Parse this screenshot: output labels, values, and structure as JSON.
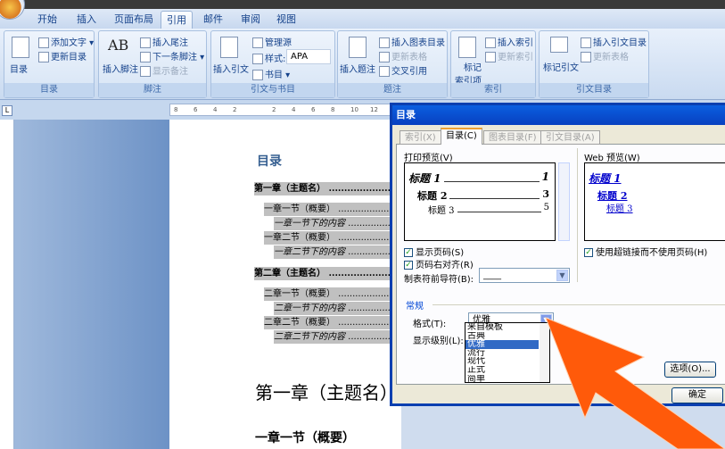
{
  "ribbon": {
    "tabs": [
      "开始",
      "插入",
      "页面布局",
      "引用",
      "邮件",
      "审阅",
      "视图"
    ],
    "active_tab": "引用",
    "groups": {
      "toc": {
        "label": "目录",
        "big": "目录",
        "add_text": "添加文字",
        "update": "更新目录"
      },
      "footnote": {
        "label": "脚注",
        "big": "插入脚注",
        "endnote": "插入尾注",
        "next": "下一条脚注",
        "show": "显示备注",
        "ab": "AB"
      },
      "citation": {
        "label": "引文与书目",
        "big": "插入引文",
        "manage": "管理源",
        "style_label": "样式:",
        "style_value": "APA",
        "biblio": "书目"
      },
      "caption": {
        "label": "题注",
        "big": "插入题注",
        "insert_figures": "插入图表目录",
        "update": "更新表格",
        "cross": "交叉引用"
      },
      "index": {
        "label": "索引",
        "big1": "标记",
        "big2": "索引项",
        "insert": "插入索引",
        "update": "更新索引"
      },
      "authorities": {
        "label": "引文目录",
        "big": "标记引文",
        "insert": "插入引文目录",
        "update": "更新表格"
      }
    }
  },
  "ruler": {
    "ticks": [
      "8",
      "6",
      "4",
      "2",
      "",
      "2",
      "4",
      "6",
      "8",
      "10",
      "12"
    ]
  },
  "document": {
    "heading": "目录",
    "toc": [
      {
        "t": "第一章（主题名）",
        "lvl": 1
      },
      {
        "t": "一章一节（概要）",
        "lvl": 2
      },
      {
        "t": "一章一节下的内容",
        "lvl": 3
      },
      {
        "t": "一章二节（概要）",
        "lvl": 2
      },
      {
        "t": "一章二节下的内容",
        "lvl": 3
      },
      {
        "t": "第二章（主题名）",
        "lvl": 1
      },
      {
        "t": "二章一节（概要）",
        "lvl": 2
      },
      {
        "t": "二章一节下的内容",
        "lvl": 3
      },
      {
        "t": "二章二节（概要）",
        "lvl": 2
      },
      {
        "t": "二章二节下的内容",
        "lvl": 3
      }
    ],
    "chapter": "第一章（主题名）",
    "section": "一章一节（概要）"
  },
  "dialog": {
    "title": "目录",
    "tabs": [
      "索引(X)",
      "目录(C)",
      "图表目录(F)",
      "引文目录(A)"
    ],
    "active_tab": 1,
    "print_preview_label": "打印预览(V)",
    "print_preview": [
      {
        "t": "标题 1",
        "p": "1"
      },
      {
        "t": "标题 2",
        "p": "3"
      },
      {
        "t": "标题 3",
        "p": "5"
      }
    ],
    "web_preview_label": "Web 预览(W)",
    "web_preview": [
      "标题 1",
      "标题 2",
      "标题 3"
    ],
    "show_page_numbers": "显示页码(S)",
    "right_align": "页码右对齐(R)",
    "tab_leader_label": "制表符前导符(B):",
    "tab_leader_value": "____",
    "use_hyperlinks": "使用超链接而不使用页码(H)",
    "general": "常规",
    "format_label": "格式(T):",
    "format_value": "优雅",
    "levels_label": "显示级别(L):",
    "format_options": [
      "来自模板",
      "古典",
      "优雅",
      "流行",
      "现代",
      "正式",
      "简单"
    ],
    "selected_option": 2,
    "options_button": "选项(O)...",
    "ok_button": "确定"
  },
  "colors": {
    "accent": "#ff5a0a",
    "title_bar": "#0a4fd0"
  }
}
